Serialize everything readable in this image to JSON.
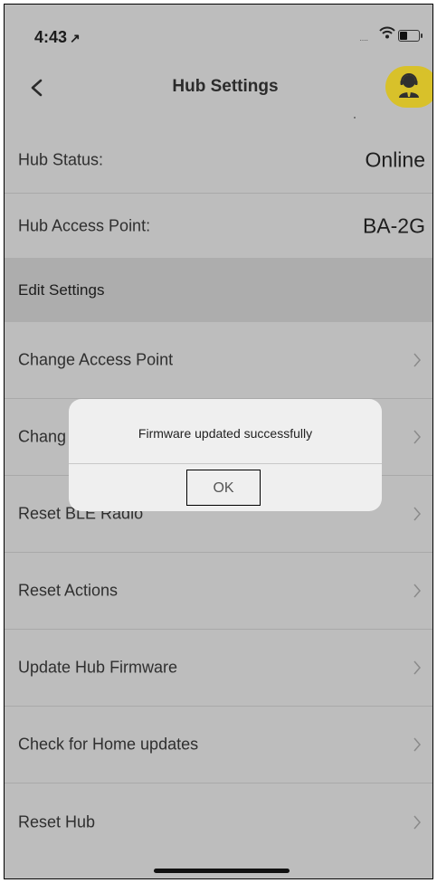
{
  "status_bar": {
    "time": "4:43",
    "location_glyph": "↗",
    "signal": "․․․․"
  },
  "nav": {
    "title": "Hub Settings"
  },
  "info_rows": [
    {
      "label": "Hub Status:",
      "value": "Online"
    },
    {
      "label": "Hub Access Point:",
      "value": "BA-2G"
    }
  ],
  "section_header": "Edit Settings",
  "menu_items": [
    {
      "label": "Change Access Point"
    },
    {
      "label": "Chang"
    },
    {
      "label": "Reset BLE Radio"
    },
    {
      "label": "Reset Actions"
    },
    {
      "label": "Update Hub Firmware"
    },
    {
      "label": "Check for Home updates"
    },
    {
      "label": "Reset Hub"
    }
  ],
  "alert": {
    "message": "Firmware updated successfully",
    "ok_label": "OK"
  },
  "colors": {
    "background": "#bdbdbd",
    "section_header": "#adadad",
    "support_accent": "#d8c12a",
    "alert_bg": "#efefef"
  }
}
